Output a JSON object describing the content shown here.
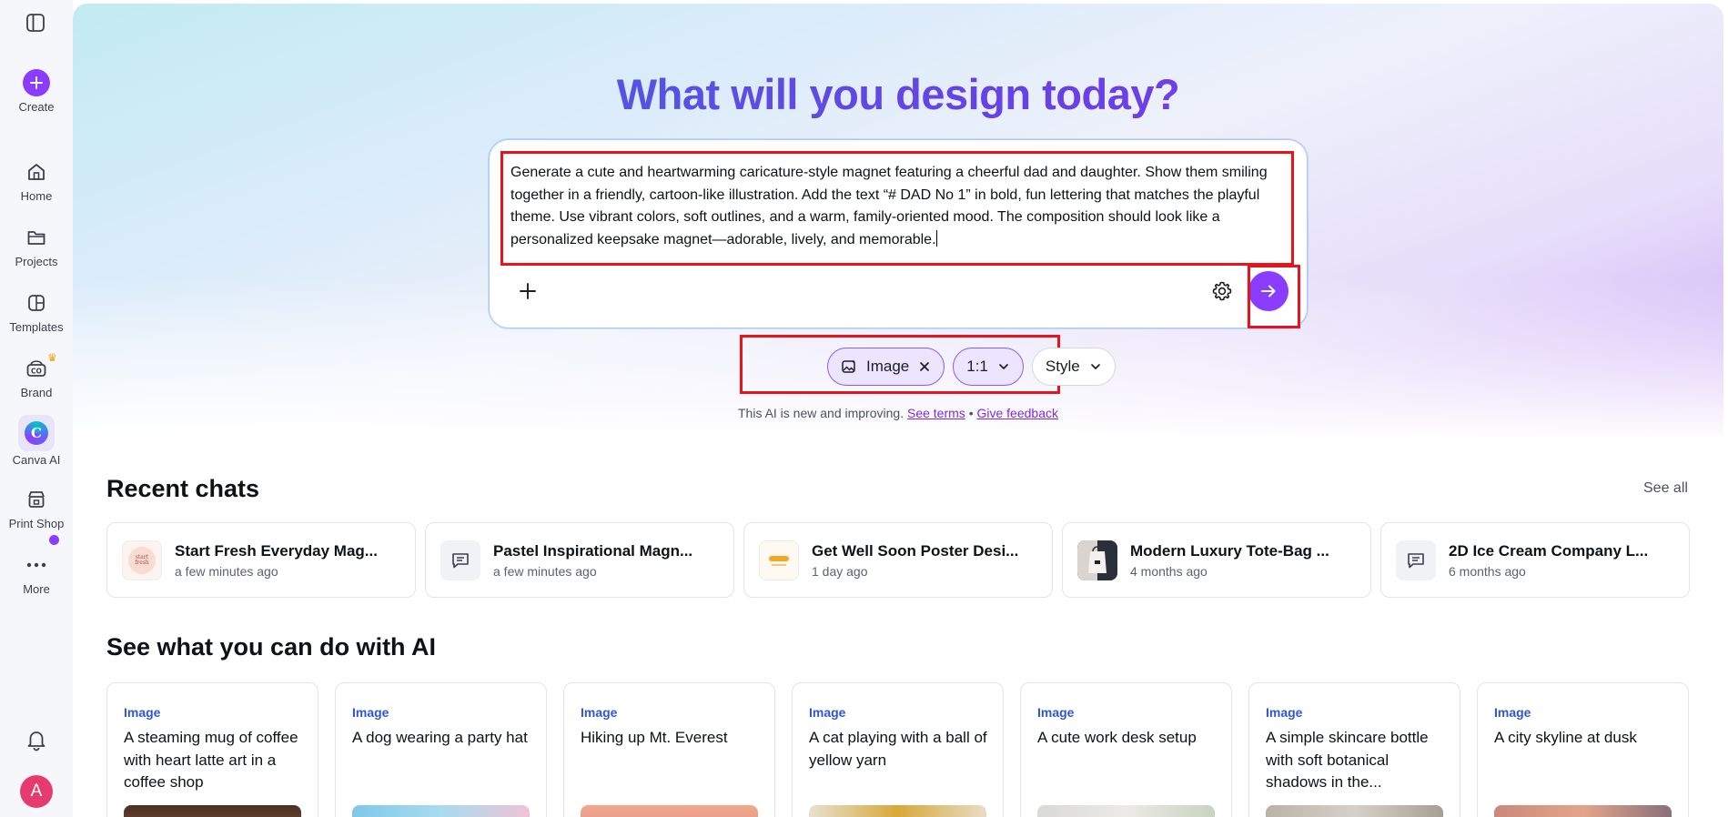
{
  "sidebar": {
    "items": [
      {
        "label": "Create"
      },
      {
        "label": "Home"
      },
      {
        "label": "Projects"
      },
      {
        "label": "Templates"
      },
      {
        "label": "Brand"
      },
      {
        "label": "Canva AI"
      },
      {
        "label": "Print Shop"
      },
      {
        "label": "More"
      }
    ],
    "avatar_initial": "A"
  },
  "hero": {
    "title": "What will you design today?",
    "prompt_text": "Generate a cute and heartwarming caricature-style magnet featuring a cheerful dad and daughter. Show them smiling together in a friendly, cartoon-like illustration. Add the text “# DAD No 1” in bold, fun lettering that matches the playful theme. Use vibrant colors, soft outlines, and a warm, family-oriented mood. The composition should look like a personalized keepsake magnet—adorable, lively, and memorable."
  },
  "chips": {
    "image_label": "Image",
    "ratio_label": "1:1",
    "style_label": "Style"
  },
  "disclaimer": {
    "text": "This AI is new and improving.",
    "terms_link": "See terms",
    "separator": "•",
    "feedback_link": "Give feedback"
  },
  "recent_chats": {
    "heading": "Recent chats",
    "see_all": "See all",
    "items": [
      {
        "title": "Start Fresh Everyday Mag...",
        "time": "a few minutes ago"
      },
      {
        "title": "Pastel Inspirational Magn...",
        "time": "a few minutes ago"
      },
      {
        "title": "Get Well Soon Poster Desi...",
        "time": "1 day ago"
      },
      {
        "title": "Modern Luxury Tote-Bag ...",
        "time": "4 months ago"
      },
      {
        "title": "2D Ice Cream Company L...",
        "time": "6 months ago"
      }
    ]
  },
  "ai_section": {
    "heading": "See what you can do with AI",
    "cards": [
      {
        "tag": "Image",
        "desc": "A steaming mug of coffee with heart latte art in a coffee shop"
      },
      {
        "tag": "Image",
        "desc": "A dog wearing a party hat"
      },
      {
        "tag": "Image",
        "desc": "Hiking up Mt. Everest"
      },
      {
        "tag": "Image",
        "desc": "A cat playing with a ball of yellow yarn"
      },
      {
        "tag": "Image",
        "desc": "A cute work desk setup"
      },
      {
        "tag": "Image",
        "desc": "A simple skincare bottle with soft botanical shadows in the..."
      },
      {
        "tag": "Image",
        "desc": "A city skyline at dusk"
      }
    ]
  },
  "colors": {
    "brand": "#8b3dff",
    "highlight": "#e8141b"
  }
}
